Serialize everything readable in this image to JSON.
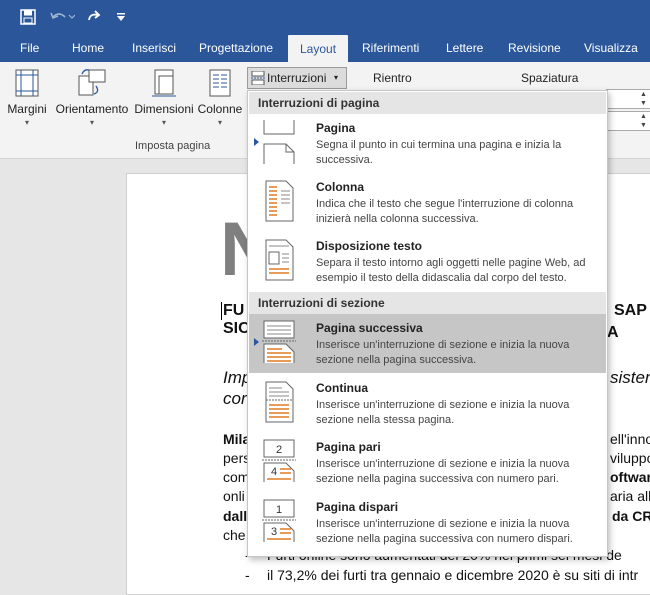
{
  "colors": {
    "brand": "#2b579a",
    "selected_item": "#c6c6c6",
    "icon_orange": "#e07b24"
  },
  "qat": {
    "save_icon": "save-icon",
    "undo_icon": "undo-icon",
    "redo_icon": "redo-icon",
    "customize_icon": "customize-icon"
  },
  "tabs": [
    {
      "label": "File"
    },
    {
      "label": "Home"
    },
    {
      "label": "Inserisci"
    },
    {
      "label": "Progettazione"
    },
    {
      "label": "Layout"
    },
    {
      "label": "Riferimenti"
    },
    {
      "label": "Lettere"
    },
    {
      "label": "Revisione"
    },
    {
      "label": "Visualizza"
    }
  ],
  "ribbon": {
    "margini": "Margini",
    "orientamento": "Orientamento",
    "dimensioni": "Dimensioni",
    "colonne": "Colonne",
    "interruzioni": "Interruzioni",
    "rientro": "Rientro",
    "spaziatura": "Spaziatura",
    "group_label": "Imposta pagina"
  },
  "document": {
    "big_letter": "N",
    "heading_line1_left": "FU",
    "heading_line1_right": "SAP",
    "heading_line2_left": "SIC",
    "heading_line2_right": "A",
    "sub_line1_left": "Imp",
    "sub_line1_right": "sistem",
    "sub_line2_left": "cor",
    "body": [
      {
        "left": "Mila",
        "right": "ell'inno"
      },
      {
        "left": "pers",
        "right": "viluppo"
      },
      {
        "left": "com",
        "right": "oftware"
      },
      {
        "left": "onli",
        "right": "aria all"
      },
      {
        "left": "dall",
        "right": "da CR"
      },
      {
        "left": "che",
        "right": ""
      }
    ],
    "bullet1": "Furti online sono aumentati del 20% nei primi sei mesi de",
    "bullet2": "il 73,2% dei furti tra gennaio e dicembre 2020 è su siti di intr"
  },
  "menu": {
    "section1": "Interruzioni di pagina",
    "section2": "Interruzioni di sezione",
    "items": [
      {
        "title": "Pagina",
        "desc": "Segna il punto in cui termina una pagina e inizia la successiva."
      },
      {
        "title": "Colonna",
        "desc": "Indica che il testo che segue l'interruzione di colonna inizierà nella colonna successiva."
      },
      {
        "title": "Disposizione testo",
        "desc": "Separa il testo intorno agli oggetti nelle pagine Web, ad esempio il testo della didascalia dal corpo del testo."
      },
      {
        "title": "Pagina successiva",
        "desc": "Inserisce un'interruzione di sezione e inizia la nuova sezione nella pagina successiva."
      },
      {
        "title": "Continua",
        "desc": "Inserisce un'interruzione di sezione e inizia la nuova sezione nella stessa pagina."
      },
      {
        "title": "Pagina pari",
        "desc": "Inserisce un'interruzione di sezione e inizia la nuova sezione nella pagina successiva con numero pari."
      },
      {
        "title": "Pagina dispari",
        "desc": "Inserisce un'interruzione di sezione e inizia la nuova sezione nella pagina successiva con numero dispari."
      }
    ],
    "even_icon_numbers": [
      "2",
      "4"
    ],
    "odd_icon_numbers": [
      "1",
      "3"
    ]
  }
}
